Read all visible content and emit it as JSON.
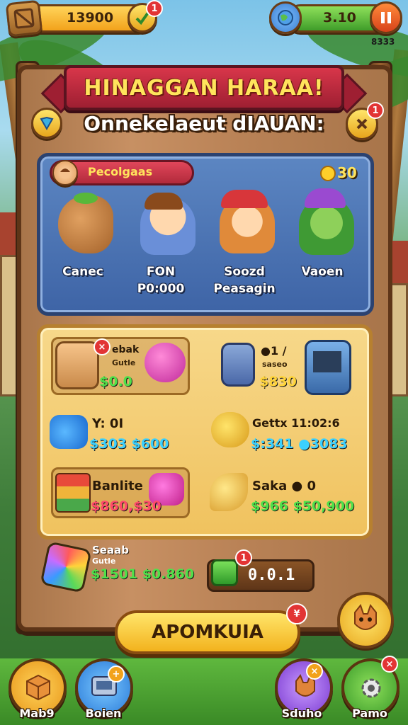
{
  "top_bar": {
    "coins_value": "13900",
    "coins_badge": "1",
    "energy_value": "3.10",
    "timer_text": "8333"
  },
  "banner": {
    "title": "HINAGGAN HARAA!",
    "subtitle": "Onnekelaeut dIAUAN:",
    "right_badge": "1"
  },
  "characters_panel": {
    "chip_label": "Pecolgaas",
    "coin_amount": "30",
    "characters": [
      {
        "label": "Canec"
      },
      {
        "label": "FON\nP0:000"
      },
      {
        "label": "Soozd\nPeasagin"
      },
      {
        "label": "Vaoen"
      }
    ]
  },
  "shop": {
    "items": [
      {
        "name": "ebak",
        "sub": "Gutle",
        "price": "$0.0",
        "price_color": "green"
      },
      {
        "name": "●1 /",
        "sub": "saseo",
        "price": "$830",
        "price_color": "gold"
      },
      {
        "name": "Y: 0I",
        "sub": "",
        "price": "$303 $600",
        "price_color": "blue"
      },
      {
        "name": "Gettx 11:02:6",
        "sub": "",
        "price": "$:341 ●3083",
        "price_color": "blue"
      },
      {
        "name": "Banlite",
        "sub": "",
        "price": "$860,$30",
        "price_color": "red"
      },
      {
        "name": "Saka ● 0",
        "sub": "",
        "price": "$966 $50,900",
        "price_color": "green"
      }
    ]
  },
  "bottom_offer": {
    "name": "Seaab",
    "sub": "Gutle",
    "price": "$1501 $0.860",
    "counter_badge": "1",
    "counter_value": "0.0.1"
  },
  "cta": {
    "label": "APOMKUIA",
    "badge": "¥"
  },
  "nav": {
    "items": [
      {
        "label": "Mab9"
      },
      {
        "label": "Boien"
      },
      {
        "label": "Sduho"
      },
      {
        "label": "Pamo"
      }
    ],
    "settings_badge": "×"
  }
}
